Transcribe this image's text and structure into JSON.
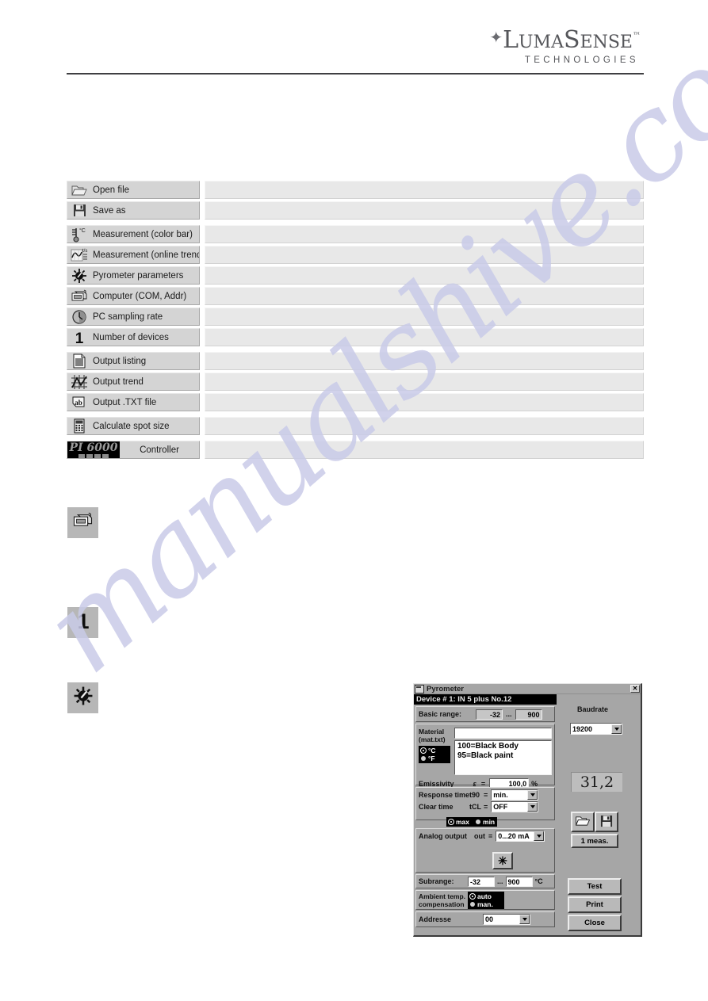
{
  "header": {
    "logo_star": "✦",
    "logo_lines": [
      "LumaSense",
      "TECHNOLOGIES"
    ],
    "logo_tm": "™",
    "logo_l": "L",
    "logo_uma": "UMA",
    "logo_s": "S",
    "logo_ense": "ENSE"
  },
  "watermark": {
    "text": "manualshive.com"
  },
  "menu": {
    "items": [
      {
        "label": "Open file",
        "icon": "open-folder-icon",
        "group": 1
      },
      {
        "label": "Save as",
        "icon": "floppy-disk-icon",
        "group": 1
      },
      {
        "label": "Measurement (color bar)",
        "icon": "thermometer-icon",
        "group": 2
      },
      {
        "label": "Measurement (online trend)",
        "icon": "trend-chart-icon",
        "group": 2
      },
      {
        "label": "Pyrometer parameters",
        "icon": "sun-gear-icon",
        "group": 2
      },
      {
        "label": "Computer (COM, Addr)",
        "icon": "computer-icon",
        "group": 2
      },
      {
        "label": "PC sampling rate",
        "icon": "clock-icon",
        "group": 2
      },
      {
        "label": "Number of devices",
        "icon": "number-one-icon",
        "group": 2
      },
      {
        "label": "Output listing",
        "icon": "document-list-icon",
        "group": 3
      },
      {
        "label": "Output trend",
        "icon": "grid-trend-icon",
        "group": 3
      },
      {
        "label": "Output .TXT file",
        "icon": "ab-text-icon",
        "group": 3
      },
      {
        "label": "Calculate spot size",
        "icon": "calculator-icon",
        "group": 4
      },
      {
        "label": "Controller",
        "icon": "pi6000-badge",
        "group": 5,
        "badge": "PI 6000"
      }
    ]
  },
  "standalone_icons": [
    {
      "name": "computer-icon",
      "label": "computer"
    },
    {
      "name": "number-one-icon",
      "label": "1"
    },
    {
      "name": "sun-gear-icon",
      "label": "pyrometer"
    }
  ],
  "dialog": {
    "title": "Pyrometer",
    "close_label": "✕",
    "device_header": "Device # 1: IN 5 plus  No.12",
    "basic_range": {
      "label": "Basic range:",
      "min": "-32",
      "sep": "...",
      "max": "900"
    },
    "material": {
      "label_line1": "Material",
      "label_line2": "(mat.txt)",
      "value": "",
      "list": [
        "100=Black Body",
        "95=Black paint"
      ]
    },
    "units": {
      "celsius": "°C",
      "fahrenheit": "°F",
      "selected": "°C"
    },
    "emissivity": {
      "label": "Emissivity",
      "symbol": "ε",
      "eq": "=",
      "value": "100,0",
      "unit": "%"
    },
    "response_time": {
      "label": "Response time",
      "symbol": "t90",
      "eq": "=",
      "value": "min."
    },
    "clear_time": {
      "label": "Clear time",
      "symbol": "tCL",
      "eq": "=",
      "value": "OFF"
    },
    "maxmin": {
      "max": "max",
      "min": "min",
      "selected": "max"
    },
    "analog_output": {
      "label": "Analog output",
      "symbol": "out",
      "eq": "=",
      "value": "0...20 mA"
    },
    "laser_button": "✳",
    "subrange": {
      "label": "Subrange:",
      "min": "-32",
      "sep": "...",
      "max": "900",
      "unit": "°C"
    },
    "ambient": {
      "label_line1": "Ambient temp.",
      "label_line2": "compensation",
      "auto": "auto",
      "man": "man.",
      "selected": "auto"
    },
    "address": {
      "label": "Addresse",
      "value": "00"
    },
    "baudrate": {
      "label": "Baudrate",
      "value": "19200"
    },
    "reading": "31,2",
    "meas_button": "1 meas.",
    "open_icon": "open-folder-icon",
    "save_icon": "floppy-disk-icon",
    "buttons": [
      {
        "label": "Test",
        "accel": "T"
      },
      {
        "label": "Print",
        "accel": "P"
      },
      {
        "label": "Close",
        "accel": "C"
      }
    ]
  }
}
